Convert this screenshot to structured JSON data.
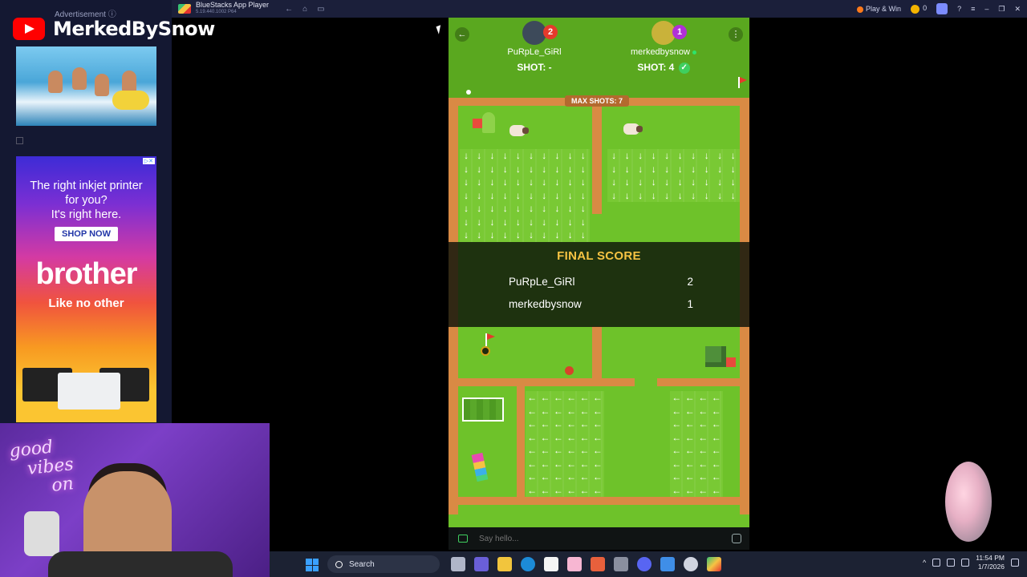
{
  "window": {
    "app_title": "BlueStacks App Player",
    "app_subtitle": "5.19.440.1002  P64",
    "play_win_label": "Play & Win",
    "coins": "0"
  },
  "ad_sidebar": {
    "label": "Advertisement ⓘ",
    "printer_ad": {
      "headline_line1": "The right inkjet printer",
      "headline_line2": "for you?",
      "headline_line3": "It's right here.",
      "cta": "SHOP NOW",
      "brand": "brother",
      "tagline": "Like no other"
    }
  },
  "channel": {
    "name": "MerkedBySnow"
  },
  "webcam": {
    "neon_line1": "good",
    "neon_line2": "vibes",
    "neon_line3": "on"
  },
  "game": {
    "players": [
      {
        "name": "PuRpLe_GiRl",
        "badge": "2",
        "shot": "SHOT: -",
        "badge_color": "#e53a2c"
      },
      {
        "name": "merkedbysnow",
        "badge": "1",
        "shot": "SHOT: 4",
        "badge_color": "#b12fd6",
        "online": true,
        "check": "✓"
      }
    ],
    "max_shots_label": "MAX SHOTS: 7",
    "final_score": {
      "title": "FINAL SCORE",
      "rows": [
        {
          "name": "PuRpLe_GiRl",
          "score": "2"
        },
        {
          "name": "merkedbysnow",
          "score": "1"
        }
      ]
    },
    "chat_placeholder": "Say hello..."
  },
  "taskbar": {
    "search_label": "Search",
    "time": "11:54 PM",
    "date": "1/7/2026"
  },
  "icons": {
    "back": "←",
    "menu": "⋮",
    "arrow_down": "↓",
    "arrow_left": "←"
  }
}
